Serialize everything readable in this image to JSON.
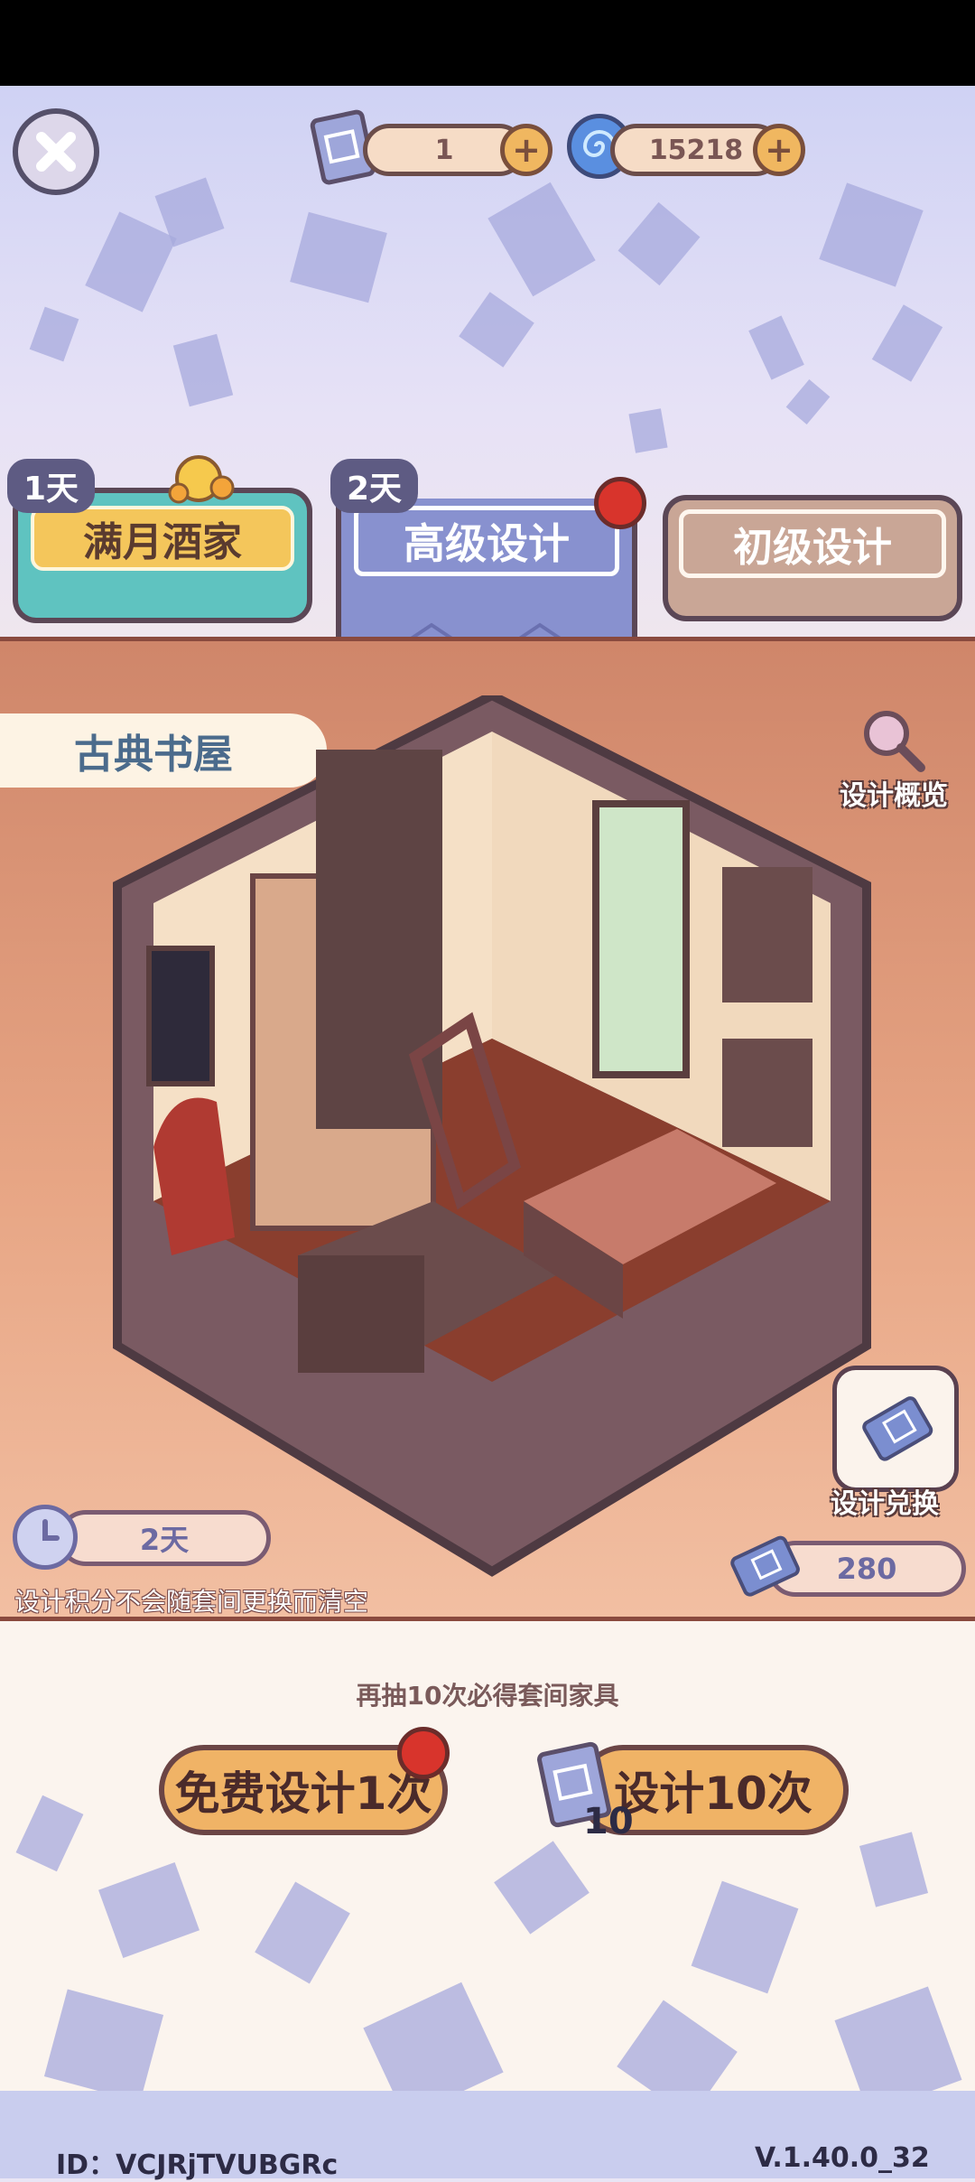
{
  "topbar": {
    "blueprint_count": "1",
    "gem_count": "15218"
  },
  "tabs": {
    "moon": {
      "badge": "1天",
      "label": "满月酒家"
    },
    "advanced": {
      "badge": "2天",
      "label": "高级设计"
    },
    "basic": {
      "label": "初级设计"
    }
  },
  "room": {
    "name": "古典书屋",
    "overview_label": "设计概览",
    "exchange_label": "设计兑换",
    "timer": "2天",
    "points": "280",
    "notice": "设计积分不会随套间更换而清空"
  },
  "draw": {
    "guarantee": "再抽10次必得套间家具",
    "free_label": "免费设计1次",
    "ten_label": "设计10次",
    "ten_cost": "10"
  },
  "footer": {
    "id": "ID：VCJRjTVUBGRc",
    "version": "V.1.40.0_32"
  },
  "colors": {
    "accent_gold": "#f0b366",
    "tab_active": "#8891cf",
    "room_bg": "#e7a584",
    "badge_red": "#d8342c"
  }
}
